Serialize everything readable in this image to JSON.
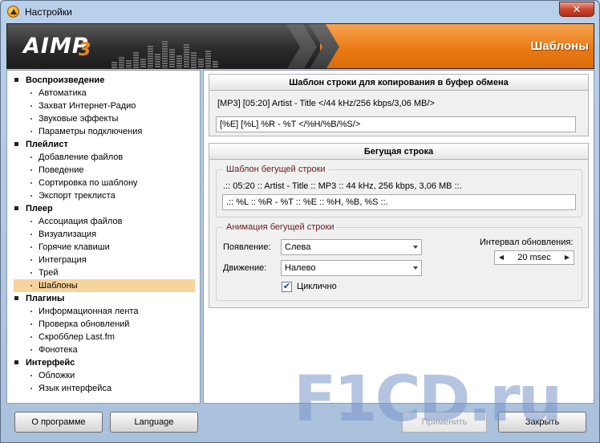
{
  "window": {
    "title": "Настройки",
    "close_glyph": "✕"
  },
  "header": {
    "logo_text": "AIMP",
    "logo_version": "3",
    "section_title": "Шаблоны"
  },
  "nav": {
    "items": [
      {
        "label": "Воспроизведение",
        "type": "group"
      },
      {
        "label": "Автоматика",
        "type": "sub"
      },
      {
        "label": "Захват Интернет-Радио",
        "type": "sub"
      },
      {
        "label": "Звуковые эффекты",
        "type": "sub"
      },
      {
        "label": "Параметры подключения",
        "type": "sub"
      },
      {
        "label": "Плейлист",
        "type": "group"
      },
      {
        "label": "Добавление файлов",
        "type": "sub"
      },
      {
        "label": "Поведение",
        "type": "sub"
      },
      {
        "label": "Сортировка по шаблону",
        "type": "sub"
      },
      {
        "label": "Экспорт треклиста",
        "type": "sub"
      },
      {
        "label": "Плеер",
        "type": "group"
      },
      {
        "label": "Ассоциация файлов",
        "type": "sub"
      },
      {
        "label": "Визуализация",
        "type": "sub"
      },
      {
        "label": "Горячие клавиши",
        "type": "sub"
      },
      {
        "label": "Интеграция",
        "type": "sub"
      },
      {
        "label": "Трей",
        "type": "sub"
      },
      {
        "label": "Шаблоны",
        "type": "sub",
        "selected": true
      },
      {
        "label": "Плагины",
        "type": "group"
      },
      {
        "label": "Информационная лента",
        "type": "sub"
      },
      {
        "label": "Проверка обновлений",
        "type": "sub"
      },
      {
        "label": "Скробблер Last.fm",
        "type": "sub"
      },
      {
        "label": "Фонотека",
        "type": "sub"
      },
      {
        "label": "Интерфейс",
        "type": "group"
      },
      {
        "label": "Обложки",
        "type": "sub"
      },
      {
        "label": "Язык интерфейса",
        "type": "sub"
      }
    ]
  },
  "clipboard": {
    "title": "Шаблон строки для копирования в буфер обмена",
    "preview": "[MP3] [05:20] Artist - Title   </44 kHz/256 kbps/3,06 MB/>",
    "template": "[%E] [%L] %R - %T   </%H/%B/%S/>"
  },
  "ticker": {
    "title": "Бегущая строка",
    "template_group": {
      "legend": "Шаблон бегущей строки",
      "preview": ".:: 05:20 :: Artist - Title :: MP3 :: 44 kHz, 256 kbps, 3,06 MB ::.",
      "template": ".:: %L :: %R - %T :: %E :: %H, %B, %S ::."
    },
    "animation_group": {
      "legend": "Анимация бегущей строки",
      "appearance_label": "Появление:",
      "appearance_value": "Слева",
      "movement_label": "Движение:",
      "movement_value": "Налево",
      "interval_label": "Интервал обновления:",
      "interval_value": "20 msec",
      "cyclic_label": "Циклично",
      "cyclic_checked": true
    }
  },
  "buttons": {
    "about": "О программе",
    "language": "Language",
    "apply": "Применить",
    "close": "Закрыть"
  },
  "watermark": "F1CD.ru",
  "colors": {
    "accent": "#ea7a14",
    "selection": "#f7d39d",
    "legend": "#6b1a1a"
  }
}
